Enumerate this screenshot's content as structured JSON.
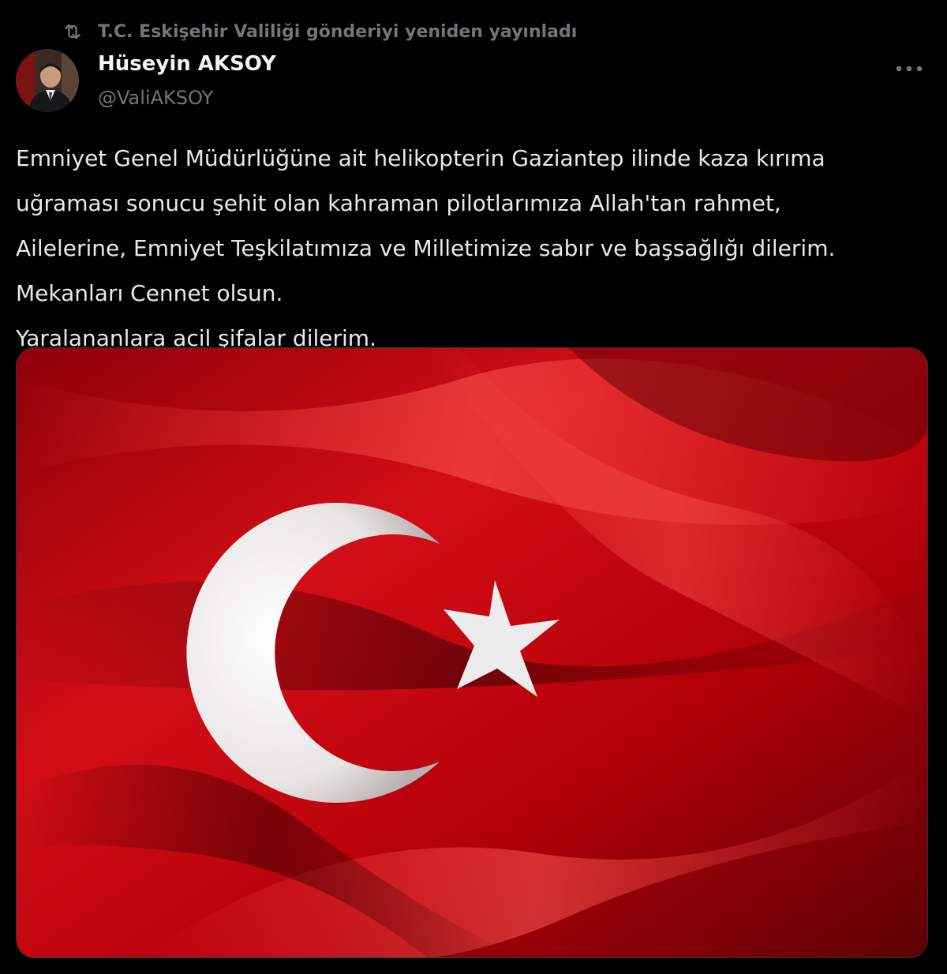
{
  "repost": {
    "icon": "repost-icon",
    "text": "T.C. Eskişehir Valiliği gönderiyi yeniden yayınladı"
  },
  "author": {
    "name": "Hüseyin AKSOY",
    "handle": "@ValiAKSOY",
    "avatar": "avatar"
  },
  "more_icon": "more-horizontal-icon",
  "tweet": {
    "lines": [
      "Emniyet Genel Müdürlüğüne ait helikopterin Gaziantep ilinde kaza kırıma",
      "uğraması sonucu şehit olan kahraman pilotlarımıza Allah'tan rahmet,",
      "Ailelerine, Emniyet Teşkilatımıza ve Milletimize sabır ve başsağlığı dilerim.",
      "Mekanları Cennet olsun.",
      "Yaralananlara acil şifalar dilerim."
    ]
  },
  "media": {
    "image": "turkish-flag-image"
  },
  "colors": {
    "background": "#000000",
    "text": "#e7e9ea",
    "secondary_text": "#71767b",
    "flag_red": "#d10a14",
    "flag_white": "#ffffff"
  }
}
